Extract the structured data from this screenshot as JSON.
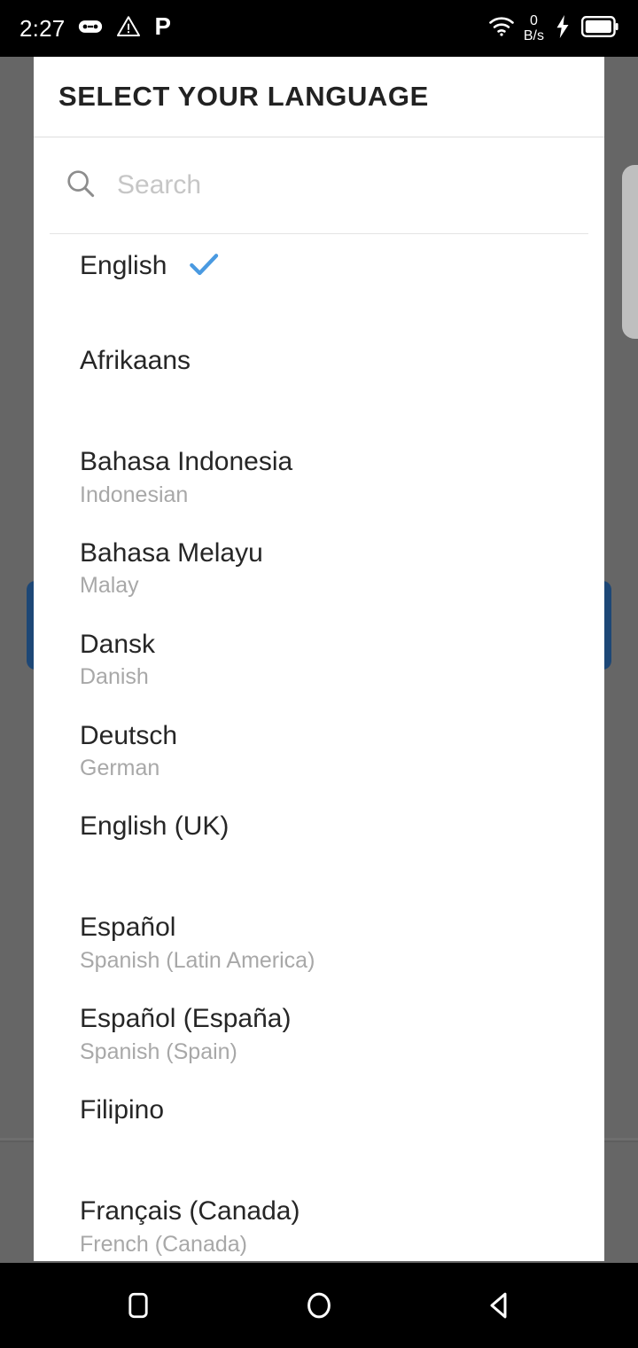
{
  "status_bar": {
    "clock": "2:27",
    "icons_left": [
      "game-controller-icon",
      "warning-triangle-icon",
      "letter-p-icon"
    ],
    "network_speed_value": "0",
    "network_speed_unit": "B/s",
    "icons_right": [
      "wifi-icon",
      "charging-bolt-icon",
      "battery-icon"
    ]
  },
  "dialog": {
    "title": "SELECT YOUR LANGUAGE",
    "search": {
      "placeholder": "Search",
      "value": "",
      "icon": "search-icon"
    },
    "languages": [
      {
        "name": "English",
        "sub": "",
        "selected": true
      },
      {
        "name": "Afrikaans",
        "sub": "",
        "selected": false
      },
      {
        "name": "Bahasa Indonesia",
        "sub": "Indonesian",
        "selected": false
      },
      {
        "name": "Bahasa Melayu",
        "sub": "Malay",
        "selected": false
      },
      {
        "name": "Dansk",
        "sub": "Danish",
        "selected": false
      },
      {
        "name": "Deutsch",
        "sub": "German",
        "selected": false
      },
      {
        "name": "English (UK)",
        "sub": "",
        "selected": false
      },
      {
        "name": "Español",
        "sub": "Spanish (Latin America)",
        "selected": false
      },
      {
        "name": "Español (España)",
        "sub": "Spanish (Spain)",
        "selected": false
      },
      {
        "name": "Filipino",
        "sub": "",
        "selected": false
      },
      {
        "name": "Français (Canada)",
        "sub": "French (Canada)",
        "selected": false
      }
    ],
    "check_color": "#4a9ae1"
  },
  "nav_bar": {
    "buttons": [
      "recents-square-icon",
      "home-circle-icon",
      "back-triangle-icon"
    ]
  },
  "colors": {
    "scrim": "#666666",
    "dialog_bg": "#ffffff",
    "accent_blue": "#4a9ae1",
    "behind_bar_blue": "#1d4776",
    "side_handle_gray": "#bfbfbf"
  }
}
